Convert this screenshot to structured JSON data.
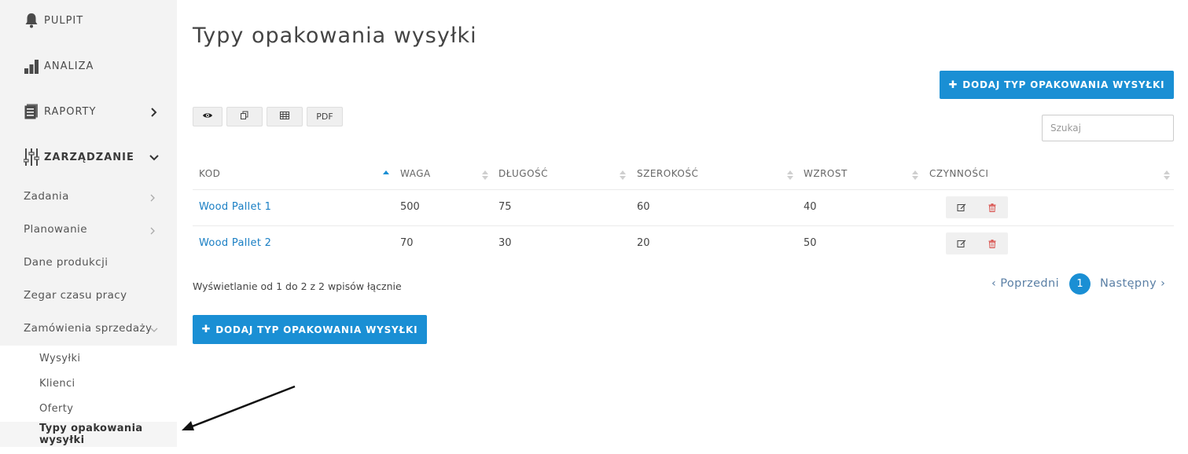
{
  "sidebar": {
    "main": [
      {
        "label": "PULPIT",
        "icon": "bell-icon"
      },
      {
        "label": "ANALIZA",
        "icon": "bar-chart-icon"
      },
      {
        "label": "RAPORTY",
        "icon": "report-icon"
      },
      {
        "label": "ZARZĄDZANIE",
        "icon": "sliders-icon"
      }
    ],
    "sub": [
      {
        "label": "Zadania"
      },
      {
        "label": "Planowanie"
      },
      {
        "label": "Dane produkcji"
      },
      {
        "label": "Zegar czasu pracy"
      },
      {
        "label": "Zamówienia sprzedaży"
      }
    ],
    "subsub": [
      {
        "label": "Wysyłki"
      },
      {
        "label": "Klienci"
      },
      {
        "label": "Oferty"
      },
      {
        "label": "Typy opakowania wysyłki"
      }
    ]
  },
  "page": {
    "title": "Typy opakowania wysyłki",
    "add_button": "DODAJ TYP OPAKOWANIA WYSYŁKI"
  },
  "toolbar": {
    "pdf_label": "PDF",
    "buttons": [
      "eye-icon",
      "copy-icon",
      "table-icon",
      "PDF"
    ]
  },
  "search": {
    "placeholder": "Szukaj",
    "value": ""
  },
  "table": {
    "columns": [
      "KOD",
      "WAGA",
      "DŁUGOŚĆ",
      "SZEROKOŚĆ",
      "WZROST",
      "CZYNNOŚCI"
    ],
    "rows": [
      {
        "kod": "Wood Pallet 1",
        "waga": "500",
        "dlugosc": "75",
        "szerokosc": "60",
        "wzrost": "40"
      },
      {
        "kod": "Wood Pallet 2",
        "waga": "70",
        "dlugosc": "30",
        "szerokosc": "20",
        "wzrost": "50"
      }
    ],
    "sorted_column": "KOD",
    "sort_direction": "ascending"
  },
  "footer": {
    "info": "Wyświetlanie od 1 do 2 z 2 wpisów łącznie",
    "prev": "Poprzedni",
    "next": "Następny",
    "current_page": "1"
  },
  "colors": {
    "primary": "#1a8fd4",
    "link": "#1a7fc4",
    "delete": "#d9534f",
    "sidebar_bg": "#f3f3f3"
  }
}
